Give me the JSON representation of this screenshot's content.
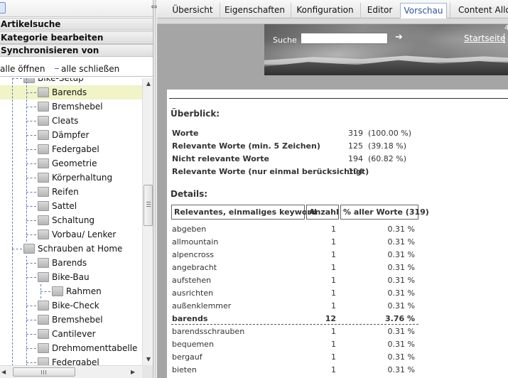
{
  "left_panel": {
    "accordion": [
      "Artikelsuche",
      "Kategorie bearbeiten",
      "Synchronisieren von"
    ],
    "tools": {
      "open_all": "alle öffnen",
      "close_all": "alle schließen"
    },
    "tree_items": [
      {
        "label": "Bike-Setup",
        "level": 1,
        "selected": false
      },
      {
        "label": "Barends",
        "level": 2,
        "selected": true
      },
      {
        "label": "Bremshebel",
        "level": 2,
        "selected": false
      },
      {
        "label": "Cleats",
        "level": 2,
        "selected": false
      },
      {
        "label": "Dämpfer",
        "level": 2,
        "selected": false
      },
      {
        "label": "Federgabel",
        "level": 2,
        "selected": false
      },
      {
        "label": "Geometrie",
        "level": 2,
        "selected": false
      },
      {
        "label": "Körperhaltung",
        "level": 2,
        "selected": false
      },
      {
        "label": "Reifen",
        "level": 2,
        "selected": false
      },
      {
        "label": "Sattel",
        "level": 2,
        "selected": false
      },
      {
        "label": "Schaltung",
        "level": 2,
        "selected": false
      },
      {
        "label": "Vorbau/ Lenker",
        "level": 2,
        "selected": false
      },
      {
        "label": "Schrauben at Home",
        "level": 1,
        "selected": false
      },
      {
        "label": "Barends",
        "level": 2,
        "selected": false
      },
      {
        "label": "Bike-Bau",
        "level": 2,
        "selected": false
      },
      {
        "label": "Rahmen",
        "level": 3,
        "selected": false
      },
      {
        "label": "Bike-Check",
        "level": 2,
        "selected": false
      },
      {
        "label": "Bremshebel",
        "level": 2,
        "selected": false
      },
      {
        "label": "Cantilever",
        "level": 2,
        "selected": false
      },
      {
        "label": "Drehmomenttabelle",
        "level": 2,
        "selected": false
      },
      {
        "label": "Federgabel",
        "level": 2,
        "selected": false
      }
    ]
  },
  "tabs": [
    {
      "label": "Übersicht",
      "active": false
    },
    {
      "label": "Eigenschaften",
      "active": false
    },
    {
      "label": "Konfiguration",
      "active": false
    },
    {
      "label": "Editor",
      "active": false
    },
    {
      "label": "Vorschau",
      "active": true
    },
    {
      "label": "Content Allo",
      "active": false
    }
  ],
  "preview": {
    "search_label": "Suche",
    "search_value": "",
    "start_link": "Startseite",
    "corner_text": "4",
    "overview_title": "Überblick:",
    "overview_rows": [
      {
        "label": "Worte",
        "count": "319",
        "pct": "(100.00 %)"
      },
      {
        "label": "Relevante Worte (min. 5 Zeichen)",
        "count": "125",
        "pct": "(39.18 %)"
      },
      {
        "label": "Nicht relevante Worte",
        "count": "194",
        "pct": "(60.82 %)"
      },
      {
        "label": "Relevante Worte (nur einmal berücksichtigt)",
        "count": "104",
        "pct": ""
      }
    ],
    "details_title": "Details:",
    "table_headers": [
      "Relevantes, einmaliges keyword",
      "Anzahl",
      "% aller Worte (319)"
    ],
    "table_rows": [
      {
        "word": "abgeben",
        "count": "1",
        "pct": "0.31 %",
        "bold": false
      },
      {
        "word": "allmountain",
        "count": "1",
        "pct": "0.31 %",
        "bold": false
      },
      {
        "word": "alpencross",
        "count": "1",
        "pct": "0.31 %",
        "bold": false
      },
      {
        "word": "angebracht",
        "count": "1",
        "pct": "0.31 %",
        "bold": false
      },
      {
        "word": "aufstehen",
        "count": "1",
        "pct": "0.31 %",
        "bold": false
      },
      {
        "word": "ausrichten",
        "count": "1",
        "pct": "0.31 %",
        "bold": false
      },
      {
        "word": "außenklemmer",
        "count": "1",
        "pct": "0.31 %",
        "bold": false
      },
      {
        "word": "barends",
        "count": "12",
        "pct": "3.76 %",
        "bold": true
      },
      {
        "word": "barendsschrauben",
        "count": "1",
        "pct": "0.31 %",
        "bold": false
      },
      {
        "word": "bequemen",
        "count": "1",
        "pct": "0.31 %",
        "bold": false
      },
      {
        "word": "bergauf",
        "count": "1",
        "pct": "0.31 %",
        "bold": false
      },
      {
        "word": "bieten",
        "count": "1",
        "pct": "0.31 %",
        "bold": false
      }
    ]
  },
  "icons": {
    "collapse_toggle": "double-arrow-icon",
    "folder": "folder-icon",
    "search_go": "arrow-right-icon"
  }
}
